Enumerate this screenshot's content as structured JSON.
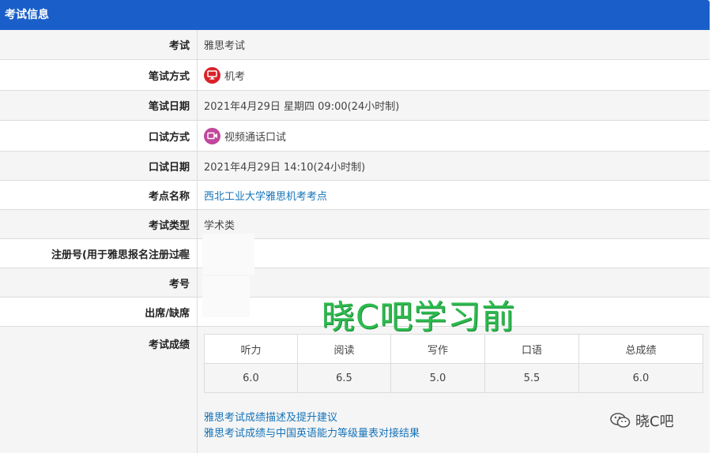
{
  "header": {
    "title": "考试信息"
  },
  "rows": [
    {
      "label": "考试",
      "value": "雅思考试"
    },
    {
      "label": "笔试方式",
      "value": "机考",
      "icon": "computer-icon"
    },
    {
      "label": "笔试日期",
      "value": "2021年4月29日 星期四 09:00(24小时制)"
    },
    {
      "label": "口试方式",
      "value": "视频通话口试",
      "icon": "video-call-icon"
    },
    {
      "label": "口试日期",
      "value": "2021年4月29日 14:10(24小时制)"
    },
    {
      "label": "考点名称",
      "value": "西北工业大学雅思机考考点"
    },
    {
      "label": "考试类型",
      "value": "学术类"
    },
    {
      "label": "注册号(用于雅思报名注册过程",
      "value": ""
    },
    {
      "label": "考号",
      "value": ""
    },
    {
      "label": "出席/缺席",
      "value": ""
    },
    {
      "label": "考试成绩"
    }
  ],
  "scores": {
    "headers": [
      "听力",
      "阅读",
      "写作",
      "口语",
      "总成绩"
    ],
    "values": [
      "6.0",
      "6.5",
      "5.0",
      "5.5",
      "6.0"
    ]
  },
  "links": {
    "score_description": "雅思考试成绩描述及提升建议",
    "cse_alignment": "雅思考试成绩与中国英语能力等级量表对接结果"
  },
  "overlay": {
    "watermark": "晓C吧学习前",
    "brand": "晓C吧"
  },
  "colors": {
    "header_bg": "#1a5fc9",
    "link": "#1473b9",
    "icon_red": "#d9222a",
    "icon_pink": "#c2479c",
    "watermark": "#2dba4e"
  }
}
